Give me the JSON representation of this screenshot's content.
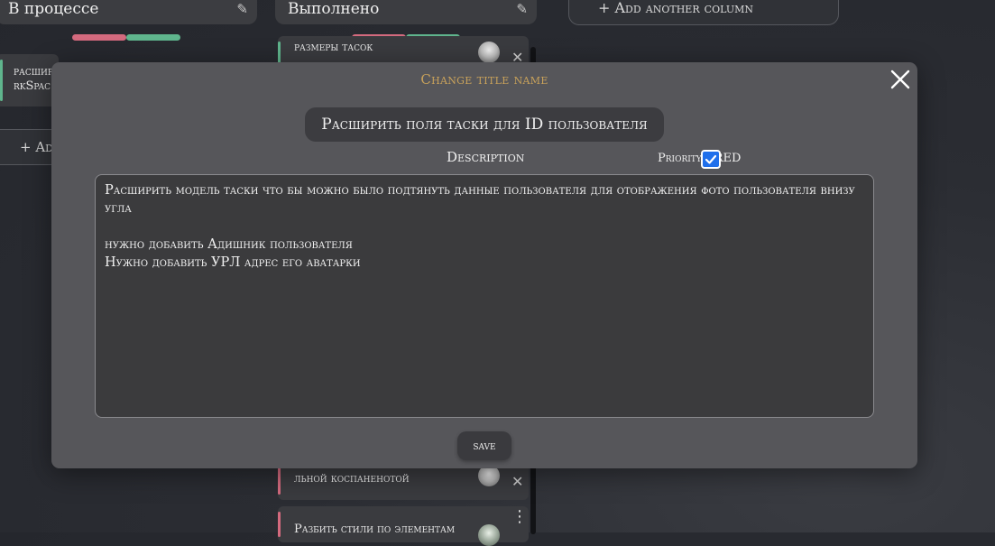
{
  "board": {
    "columns": [
      {
        "title": "В процессе",
        "edit_icon": "pencil-icon"
      },
      {
        "title": "Выполнено",
        "edit_icon": "pencil-icon"
      }
    ],
    "add_column_label": "+ Add another column",
    "left_add_label": "+ Add",
    "left_card_text": [
      "расшир",
      "rkSpac"
    ],
    "done_cards": [
      {
        "text": "размеры тасок",
        "stripe_color": "#5fb58d"
      },
      {
        "text": "льной коспаненотой",
        "stripe_color": "#d46a7e"
      },
      {
        "text": "Разбить стили по элементам",
        "stripe_color": "#d46a7e"
      }
    ],
    "colors": {
      "red": "#d46a7e",
      "green": "#5fb58d"
    }
  },
  "modal": {
    "heading": "Change title name",
    "title_value": "Расширить поля таски для ID пользователя",
    "description_label": "Description",
    "priority_label": "Priority",
    "priority_value": "RED",
    "priority_checked": true,
    "description_text": "Расширить модель таски что бы можно было подтянуть данные пользователя для отображения фото пользователя внизу угла\n\nнужно добавить Адишник пользователя\nНужно добавить УРЛ адрес его аватарки",
    "save_label": "save",
    "close_icon": "close-icon"
  }
}
